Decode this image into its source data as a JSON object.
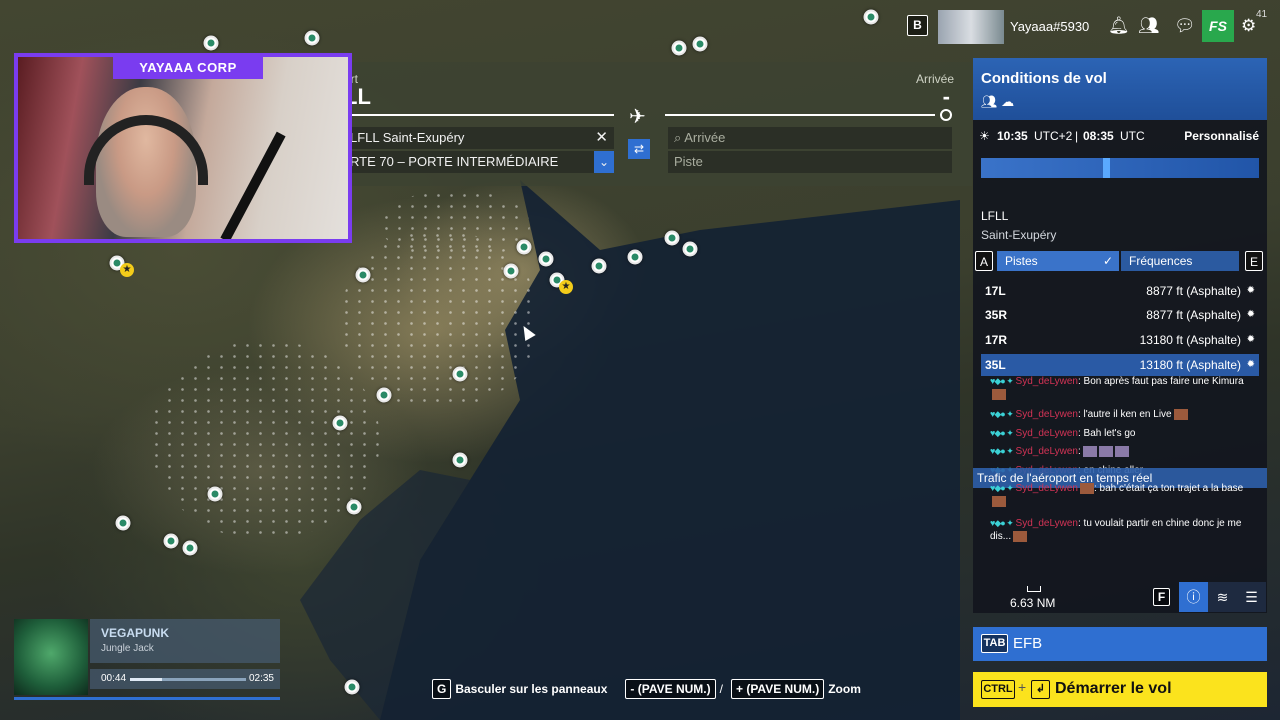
{
  "webcam": {
    "title": "YAYAAA CORP"
  },
  "flight": {
    "departure_label": "art",
    "departure_code": "LL",
    "arrival_label": "Arrivée",
    "arrival_code": "-",
    "departure_airport": "LFLL Saint-Exupéry",
    "departure_gate": "RTE 70 – PORTE INTERMÉDIAIRE",
    "arrival_placeholder": "Arrivée",
    "runway_placeholder": "Piste"
  },
  "topbar": {
    "b_key": "B",
    "username": "Yayaaa#5930",
    "shop_label": "FS",
    "notification_count": "41"
  },
  "conditions": {
    "title": "Conditions de vol",
    "local_time": "10:35",
    "local_tz": "UTC+2",
    "utc_time": "08:35",
    "utc_label": "UTC",
    "mode": "Personnalisé",
    "time_of_day_fraction": 0.44,
    "airport_code": "LFLL",
    "airport_name": "Saint-Exupéry",
    "tab_a_key": "A",
    "tab_pistes": "Pistes",
    "tab_freq": "Fréquences",
    "tab_e_key": "E",
    "runways": [
      {
        "id": "17L",
        "length": "8877 ft (Asphalte)"
      },
      {
        "id": "35R",
        "length": "8877 ft (Asphalte)"
      },
      {
        "id": "17R",
        "length": "13180 ft (Asphalte)"
      },
      {
        "id": "35L",
        "length": "13180 ft (Asphalte)"
      }
    ],
    "traffic": "Trafic de l'aéroport en temps réel",
    "scale": "6.63  NM",
    "f_key": "F"
  },
  "chat": [
    {
      "user": "Syd_deLywen",
      "msg": ": Bon après faut pas faire une Kimura"
    },
    {
      "user": "Syd_deLywen",
      "msg": ": l'autre il ken en Live"
    },
    {
      "user": "Syd_deLywen",
      "msg": ": Bah let's go"
    },
    {
      "user": "Syd_deLywen",
      "msg": ":"
    },
    {
      "user": "Syd_deLywen",
      "msg": ": en chine aller"
    },
    {
      "user": "Syd_deLywen",
      "msg": ": bah c'était ça ton trajet a la base"
    },
    {
      "user": "Syd_deLywen",
      "msg": ": tu voulait partir en chine donc je me dis..."
    }
  ],
  "efb": {
    "key": "TAB",
    "label": "EFB"
  },
  "start": {
    "key1": "CTRL",
    "plus": "+",
    "key2": "↲",
    "label": "Démarrer le vol"
  },
  "hints": [
    {
      "key": "G",
      "label": "Basculer sur les panneaux"
    },
    {
      "key": "- (PAVE NUM.)",
      "label": "/"
    },
    {
      "key": "+ (PAVE NUM.)",
      "label": "Zoom"
    }
  ],
  "music": {
    "song": "VEGAPUNK",
    "artist": "Jungle Jack",
    "elapsed": "00:44",
    "total": "02:35",
    "progress": 0.28
  },
  "colors": {
    "accent": "#2f6fd1",
    "start": "#fbe31d",
    "webcam_border": "#7a3cf0",
    "poi_green": "#2a8a67"
  }
}
